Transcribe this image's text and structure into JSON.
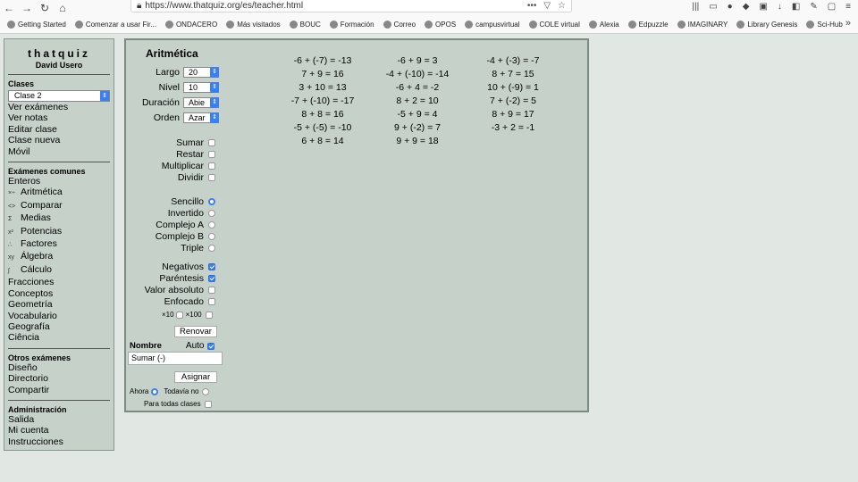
{
  "browser": {
    "url": "https://www.thatquiz.org/es/teacher.html",
    "bookmarks": [
      "Getting Started",
      "Comenzar a usar Fir...",
      "ONDACERO",
      "Más visitados",
      "BOUC",
      "Formación",
      "Correo",
      "OPOS",
      "campusvirtual",
      "COLE virtual",
      "Alexia",
      "Edpuzzle",
      "IMAGINARY",
      "Library Genesis",
      "Sci-Hub"
    ]
  },
  "sidebar": {
    "brand": "thatquiz",
    "owner": "David Usero",
    "classes_title": "Clases",
    "class_selected": "Clase 2",
    "class_links": [
      "Ver exámenes",
      "Ver notas",
      "Editar clase",
      "Clase nueva",
      "Móvil"
    ],
    "common_title": "Exámenes comunes",
    "common_links": [
      {
        "icon": "",
        "label": "Enteros"
      },
      {
        "icon": "×÷",
        "label": "Aritmética"
      },
      {
        "icon": "<>",
        "label": "Comparar"
      },
      {
        "icon": "Σ",
        "label": "Medias"
      },
      {
        "icon": "x²",
        "label": "Potencias"
      },
      {
        "icon": "∴",
        "label": "Factores"
      },
      {
        "icon": "xy",
        "label": "Álgebra"
      },
      {
        "icon": "∫",
        "label": "Cálculo"
      },
      {
        "icon": "",
        "label": "Fracciones"
      },
      {
        "icon": "",
        "label": "Conceptos"
      },
      {
        "icon": "",
        "label": "Geometría"
      },
      {
        "icon": "",
        "label": "Vocabulario"
      },
      {
        "icon": "",
        "label": "Geografía"
      },
      {
        "icon": "",
        "label": "Ciência"
      }
    ],
    "other_title": "Otros exámenes",
    "other_links": [
      "Diseño",
      "Directorio",
      "Compartir"
    ],
    "admin_title": "Administración",
    "admin_links": [
      "Salida",
      "Mi cuenta",
      "Instrucciones"
    ]
  },
  "panel": {
    "title": "Aritmética",
    "selects": [
      {
        "label": "Largo",
        "value": "20"
      },
      {
        "label": "Nivel",
        "value": "10"
      },
      {
        "label": "Duración",
        "value": "Abie"
      },
      {
        "label": "Orden",
        "value": "Azar"
      }
    ],
    "operations": [
      {
        "label": "Sumar",
        "checked": false
      },
      {
        "label": "Restar",
        "checked": false
      },
      {
        "label": "Multiplicar",
        "checked": false
      },
      {
        "label": "Dividir",
        "checked": false
      }
    ],
    "modes": [
      {
        "label": "Sencillo",
        "selected": true
      },
      {
        "label": "Invertido",
        "selected": false
      },
      {
        "label": "Complejo A",
        "selected": false
      },
      {
        "label": "Complejo B",
        "selected": false
      },
      {
        "label": "Triple",
        "selected": false
      }
    ],
    "options": [
      {
        "label": "Negativos",
        "checked": true
      },
      {
        "label": "Paréntesis",
        "checked": true
      },
      {
        "label": "Valor absoluto",
        "checked": false
      },
      {
        "label": "Enfocado",
        "checked": false
      }
    ],
    "x10_label": "×10",
    "x100_label": "×100",
    "renew_button": "Renovar",
    "name_label": "Nombre",
    "auto_label": "Auto",
    "name_value": "Sumar (-)",
    "assign_button": "Asignar",
    "now_label": "Ahora",
    "notyet_label": "Todavía no",
    "all_classes_label": "Para todas clases"
  },
  "problems": {
    "col1": [
      "-6 + (-7) = -13",
      "7 + 9 = 16",
      "3 + 10 = 13",
      "-7 + (-10) = -17",
      "8 + 8 = 16",
      "-5 + (-5) = -10",
      "6 + 8 = 14"
    ],
    "col2": [
      "-6 + 9 = 3",
      "-4 + (-10) = -14",
      "-6 + 4 = -2",
      "8 + 2 = 10",
      "-5 + 9 = 4",
      "9 + (-2) = 7",
      "9 + 9 = 18"
    ],
    "col3": [
      "-4 + (-3) = -7",
      "8 + 7 = 15",
      "10 + (-9) = 1",
      "7 + (-2) = 5",
      "8 + 9 = 17",
      "-3 + 2 = -1"
    ]
  }
}
